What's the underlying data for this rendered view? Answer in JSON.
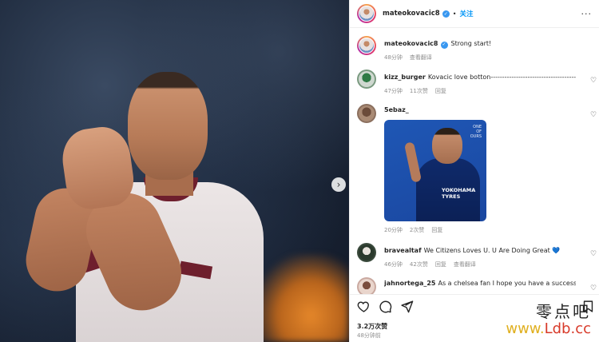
{
  "post": {
    "username": "mateokovacic8",
    "follow_label": "关注",
    "more_glyph": "···",
    "caption": {
      "text": "Strong start!",
      "time": "48分钟",
      "translate": "查看翻译"
    },
    "next_glyph": "›"
  },
  "comments": [
    {
      "user": "kizz_burger",
      "text": "Kovacic love botton-------------------------------------------------->",
      "time": "47分钟",
      "likes": "11次赞",
      "reply": "回复"
    },
    {
      "user": "5ebaz_",
      "text": "",
      "time": "20分钟",
      "likes": "2次赞",
      "reply": "回复",
      "gif": {
        "brand": "YOKOHAMA\nTYRES",
        "tag": "ONE\nOF\nOURS"
      }
    },
    {
      "user": "bravealtaf",
      "text": "We Citizens Loves U. U Are Doing Great 💙",
      "time": "46分钟",
      "likes": "42次赞",
      "reply": "回复",
      "translate": "查看翻译"
    },
    {
      "user": "jahnortega_25",
      "text": "As a chelsea fan I hope you have a successful",
      "time": "",
      "likes": "",
      "reply": ""
    }
  ],
  "footer": {
    "likes": "3.2万次赞",
    "time": "48分钟前"
  },
  "watermark": {
    "cn": "零点吧",
    "url_a": "www.",
    "url_b": "Ldb.cc"
  },
  "colors": {
    "link_blue": "#0095f6",
    "verified_blue": "#3897f0",
    "meta_gray": "#8e8e8e",
    "chelsea_blue": "#1f57b5",
    "city_maroon": "#6e1f2d"
  }
}
